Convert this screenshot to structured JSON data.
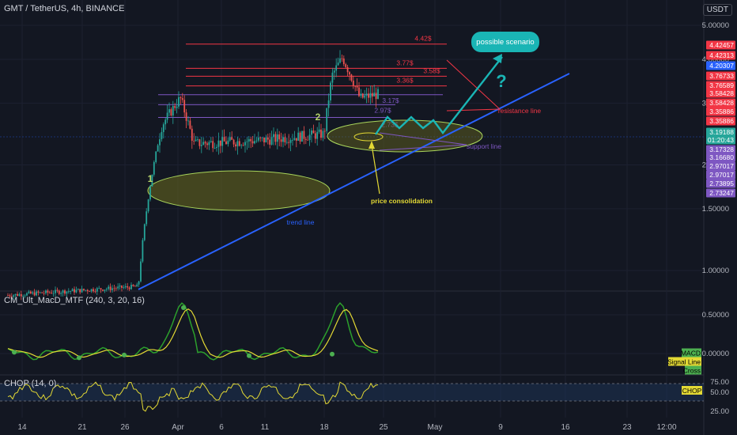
{
  "header": {
    "title": "GMT / TetherUS, 4h, BINANCE",
    "currency_badge": "USDT",
    "macd_title": "CM_Ult_MacD_MTF (240, 3, 20, 16)",
    "chop_title": "CHOP (14, 0)"
  },
  "colors": {
    "background": "#131722",
    "up": "#26a69a",
    "down": "#ef5350",
    "resistance": "#f23645",
    "support": "#7e57c2",
    "trendline": "#2962ff",
    "annotation_teal": "#1ab5b5",
    "ellipse_fill": "#6b6b1e"
  },
  "chart_data": [
    {
      "type": "candlestick",
      "title": "GMT / TetherUS, 4h, BINANCE",
      "y_scale": "log",
      "y_ticks": [
        "5.00000",
        "4.00000",
        "3.00000",
        "2.00000",
        "1.50000",
        "1.00000"
      ],
      "x_ticks": [
        "14",
        "21",
        "26",
        "Apr",
        "6",
        "11",
        "18",
        "25",
        "May",
        "9",
        "16",
        "23",
        "12:00"
      ],
      "price_axis_labels": [
        {
          "text": "4.42457",
          "color": "#f23645"
        },
        {
          "text": "4.42313",
          "color": "#f23645"
        },
        {
          "text": "4.20307",
          "color": "#2962ff"
        },
        {
          "text": "3.76733",
          "color": "#f23645"
        },
        {
          "text": "3.76589",
          "color": "#f23645"
        },
        {
          "text": "3.58428",
          "color": "#f23645"
        },
        {
          "text": "3.58428",
          "color": "#f23645"
        },
        {
          "text": "3.35886",
          "color": "#f23645"
        },
        {
          "text": "3.35886",
          "color": "#f23645"
        },
        {
          "text": "3.19188",
          "color": "#26a69a"
        },
        {
          "text": "01:20:43",
          "color": "#26a69a"
        },
        {
          "text": "3.17328",
          "color": "#7e57c2"
        },
        {
          "text": "3.16680",
          "color": "#7e57c2"
        },
        {
          "text": "2.97017",
          "color": "#7e57c2"
        },
        {
          "text": "2.97017",
          "color": "#7e57c2"
        },
        {
          "text": "2.73895",
          "color": "#7e57c2"
        },
        {
          "text": "2.73247",
          "color": "#7e57c2"
        }
      ],
      "resistance_levels": [
        {
          "value": 4.42,
          "label": "4.42$"
        },
        {
          "value": 3.77,
          "label": "3.77$"
        },
        {
          "value": 3.58,
          "label": "3.58$"
        },
        {
          "value": 3.36,
          "label": "3.36$"
        }
      ],
      "support_levels": [
        {
          "value": 3.17,
          "label": "3.17$"
        },
        {
          "value": 2.97,
          "label": "2.97$"
        },
        {
          "value": 2.73,
          "label": "2.73$"
        }
      ],
      "series_shape": [
        {
          "date": "Mar 12",
          "price": 0.85
        },
        {
          "date": "Mar 27",
          "price": 0.9
        },
        {
          "date": "Mar 31",
          "price": 2.6
        },
        {
          "date": "Apr 1",
          "price": 3.1
        },
        {
          "date": "Apr 3",
          "price": 2.3
        },
        {
          "date": "Apr 10",
          "price": 2.35
        },
        {
          "date": "Apr 17",
          "price": 2.45
        },
        {
          "date": "Apr 19",
          "price": 3.6
        },
        {
          "date": "Apr 20",
          "price": 4.05
        },
        {
          "date": "Apr 22",
          "price": 3.1
        },
        {
          "date": "Apr 24",
          "price": 3.19
        }
      ],
      "annotations": {
        "wave_1": "1",
        "wave_2": "2",
        "question": "?",
        "trend_line": "trend line",
        "resistance_line": "resistance line",
        "support_line": "support line",
        "consolidation": "price consolidation",
        "scenario": "possible scenario"
      }
    },
    {
      "type": "line",
      "title": "CM_Ult_MacD_MTF (240, 3, 20, 16)",
      "y_ticks": [
        "0.50000",
        "0.00000"
      ],
      "series": [
        {
          "name": "MACD",
          "color": "#2ca02c"
        },
        {
          "name": "Signal Line",
          "color": "#e3d934"
        }
      ],
      "badges": [
        "MACD",
        "Signal Line",
        "Cross"
      ]
    },
    {
      "type": "line",
      "title": "CHOP (14, 0)",
      "y_ticks": [
        "75.00",
        "50.00",
        "25.00"
      ],
      "current_label": "CHOP",
      "bands": [
        38.2,
        61.8
      ]
    }
  ]
}
